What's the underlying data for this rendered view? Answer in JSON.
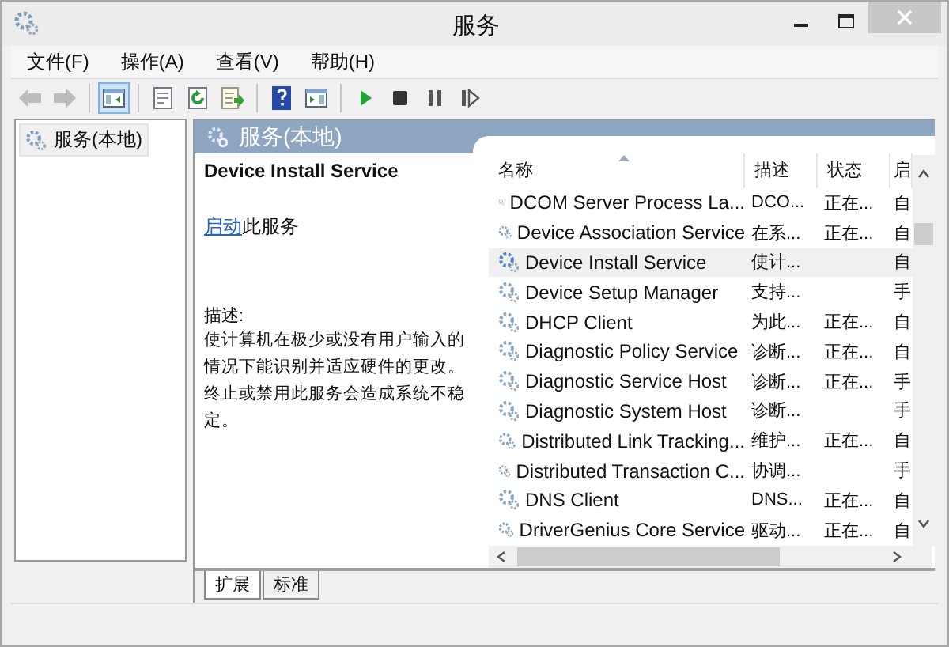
{
  "window": {
    "title": "服务"
  },
  "menu": [
    "文件(F)",
    "操作(A)",
    "查看(V)",
    "帮助(H)"
  ],
  "toolbar": [
    {
      "kind": "back",
      "disabled": true,
      "pressed": false
    },
    {
      "kind": "forward",
      "disabled": true,
      "pressed": false
    },
    {
      "kind": "separator"
    },
    {
      "kind": "tree",
      "disabled": false,
      "pressed": true
    },
    {
      "kind": "separator"
    },
    {
      "kind": "properties",
      "disabled": false,
      "pressed": false
    },
    {
      "kind": "refresh",
      "disabled": false,
      "pressed": false
    },
    {
      "kind": "export",
      "disabled": false,
      "pressed": false
    },
    {
      "kind": "separator"
    },
    {
      "kind": "help",
      "disabled": false,
      "pressed": false
    },
    {
      "kind": "pane",
      "disabled": false,
      "pressed": false
    },
    {
      "kind": "separator"
    },
    {
      "kind": "play",
      "disabled": false,
      "pressed": false
    },
    {
      "kind": "stop",
      "disabled": false,
      "pressed": false
    },
    {
      "kind": "pause",
      "disabled": false,
      "pressed": false
    },
    {
      "kind": "resume",
      "disabled": false,
      "pressed": false
    }
  ],
  "tree": {
    "items": [
      {
        "label": "服务(本地)",
        "selected": true
      }
    ]
  },
  "panel": {
    "title": "服务(本地)",
    "detail": {
      "name": "Device Install Service",
      "action_link": "启动",
      "action_text": "此服务",
      "description_label": "描述:",
      "description": "使计算机在极少或没有用户输入的情况下能识别并适应硬件的更改。终止或禁用此服务会造成系统不稳定。"
    },
    "table": {
      "columns": [
        "名称",
        "描述",
        "状态",
        "启"
      ],
      "rows": [
        {
          "name": "DCOM Server Process La...",
          "description": "DCO...",
          "status": "正在...",
          "column_4": "自",
          "selected": false
        },
        {
          "name": "Device Association Service",
          "description": "在系...",
          "status": "正在...",
          "column_4": "自",
          "selected": false
        },
        {
          "name": "Device Install Service",
          "description": "使计...",
          "status": "",
          "column_4": "自",
          "selected": true
        },
        {
          "name": "Device Setup Manager",
          "description": "支持...",
          "status": "",
          "column_4": "手",
          "selected": false
        },
        {
          "name": "DHCP Client",
          "description": "为此...",
          "status": "正在...",
          "column_4": "自",
          "selected": false
        },
        {
          "name": "Diagnostic Policy Service",
          "description": "诊断...",
          "status": "正在...",
          "column_4": "自",
          "selected": false
        },
        {
          "name": "Diagnostic Service Host",
          "description": "诊断...",
          "status": "正在...",
          "column_4": "手",
          "selected": false
        },
        {
          "name": "Diagnostic System Host",
          "description": "诊断...",
          "status": "",
          "column_4": "手",
          "selected": false
        },
        {
          "name": "Distributed Link Tracking...",
          "description": "维护...",
          "status": "正在...",
          "column_4": "自",
          "selected": false
        },
        {
          "name": "Distributed Transaction C...",
          "description": "协调...",
          "status": "",
          "column_4": "手",
          "selected": false
        },
        {
          "name": "DNS Client",
          "description": "DNS...",
          "status": "正在...",
          "column_4": "自",
          "selected": false
        },
        {
          "name": "DriverGenius Core Service",
          "description": "驱动...",
          "status": "正在...",
          "column_4": "自",
          "selected": false
        }
      ]
    },
    "tabs": [
      {
        "label": "扩展",
        "selected": true
      },
      {
        "label": "标准",
        "selected": false
      }
    ]
  }
}
